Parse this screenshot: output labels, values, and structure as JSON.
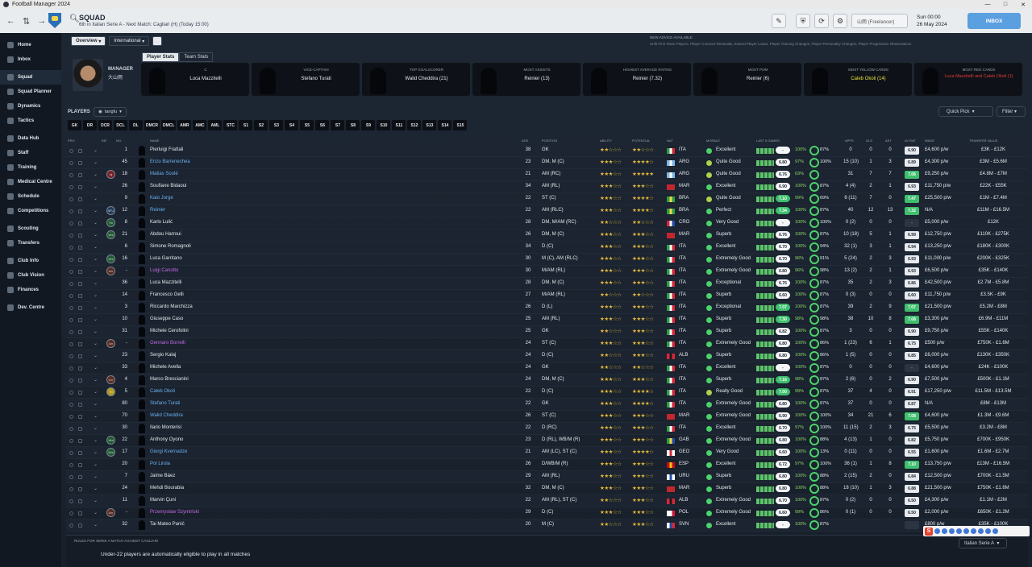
{
  "window": {
    "title": "Football Manager 2024",
    "min": "—",
    "max": "□",
    "close": "✕"
  },
  "header": {
    "title": "SQUAD",
    "subtitle": "6th in Italian Serie A - Next Match: Cagliari (H) (Today 15:00)",
    "profile": "山雨 (Freelancer)",
    "date_time": "Sun 00:00",
    "date_day": "26 May 2024",
    "inbox_label": "INBOX"
  },
  "sidebar": [
    {
      "label": "Home"
    },
    {
      "label": "Inbox"
    },
    {
      "label": "Squad",
      "active": true
    },
    {
      "label": "Squad Planner"
    },
    {
      "label": "Dynamics"
    },
    {
      "label": "Tactics"
    },
    {
      "label": "Data Hub"
    },
    {
      "label": "Staff"
    },
    {
      "label": "Training"
    },
    {
      "label": "Medical Centre"
    },
    {
      "label": "Schedule"
    },
    {
      "label": "Competitions"
    },
    {
      "label": "Scouting"
    },
    {
      "label": "Transfers"
    },
    {
      "label": "Club Info"
    },
    {
      "label": "Club Vision"
    },
    {
      "label": "Finances"
    },
    {
      "label": "Dev. Centre"
    }
  ],
  "tabs": {
    "overview": "Overview",
    "international": "International"
  },
  "advice": {
    "title": "NEW ADVICE AVAILABLE",
    "text": "Unfit First Team Players, Player Contract Renewals, Extend Player Loans, Player Training Changes, Player Personality Changes, Player Progression Observations"
  },
  "manager": {
    "label": "MANAGER",
    "name": "大山雨"
  },
  "stat_tabs": {
    "player": "Player Stats",
    "team": "Team Stats"
  },
  "cards": [
    {
      "role": "C",
      "name": "Luca Mazzitelli",
      "style": ""
    },
    {
      "role": "VICE-CAPTAIN",
      "name": "Stefano Turati",
      "style": ""
    },
    {
      "role": "TOP GOALSCORER",
      "name": "Walid Cheddira (21)",
      "style": ""
    },
    {
      "role": "MOST ASSISTS",
      "name": "Reinier (13)",
      "style": ""
    },
    {
      "role": "HIGHEST AVERAGE RATING",
      "name": "Reinier (7.32)",
      "style": ""
    },
    {
      "role": "MOST POM",
      "name": "Reinier (6)",
      "style": ""
    },
    {
      "role": "MOST YELLOW CARDS",
      "name": "Caleb Okoli (14)",
      "style": "yel"
    },
    {
      "role": "MOST RED CARDS",
      "name": "Luca Mazzitelli and Caleb Okoli (1)",
      "style": "red"
    }
  ],
  "players_bar": {
    "label": "PLAYERS",
    "view": "tangfu",
    "quick_pick": "Quick Pick",
    "filter": "Filter"
  },
  "positions": [
    "GK",
    "DR",
    "DCR",
    "DCL",
    "DL",
    "DMCR",
    "DMCL",
    "AMR",
    "AMC",
    "AML",
    "STC",
    "S1",
    "S2",
    "S3",
    "S4",
    "S5",
    "S6",
    "S7",
    "S8",
    "S9",
    "S10",
    "S11",
    "S12",
    "S13",
    "S14",
    "S15"
  ],
  "columns": {
    "pro": "PRO",
    "inf": "INF",
    "no": "NO.",
    "name": "NAME",
    "age": "AGE",
    "position": "POSITION",
    "ability": "ABILITY",
    "potential": "POTENTIAL",
    "nat": "NAT",
    "morale": "MORALE",
    "last5": "LAST 5 GAMES",
    "apps": "APPS",
    "gls": "GLS",
    "ast": "AST",
    "avrat": "AV RAT",
    "wage": "WAGE",
    "tv": "TRANSFER VALUE"
  },
  "players": [
    {
      "inf": "",
      "no": "1",
      "name": "Pierluigi Frattali",
      "age": "38",
      "pos": "GK",
      "ab": 2,
      "pot": 2,
      "flag": "ita",
      "nat": "ITA",
      "morale": "Excellent",
      "mc": "#4bd26a",
      "avg": "-",
      "fit": "100%",
      "cond": "87%",
      "apps": "0",
      "gls": "0",
      "ast": "0",
      "avr": "6.90",
      "wage": "£4,600 p/w",
      "tv": "£3K - £12K",
      "cls": ""
    },
    {
      "inf": "",
      "no": "45",
      "name": "Enzo Barrenechea",
      "age": "23",
      "pos": "DM, M (C)",
      "ab": 3,
      "pot": 4,
      "flag": "arg",
      "nat": "ARG",
      "morale": "Quite Good",
      "mc": "#a9d34c",
      "avg": "6.80",
      "fit": "97%",
      "cond": "100%",
      "apps": "15 (10)",
      "gls": "1",
      "ast": "3",
      "avr": "6.89",
      "wage": "£4,300 p/w",
      "tv": "£3M - £5.6M",
      "cls": "lnk"
    },
    {
      "inf": "Inj",
      "no": "18",
      "name": "Matias Soulé",
      "age": "21",
      "pos": "AM (RC)",
      "ab": 3,
      "pot": 5,
      "flag": "arg",
      "nat": "ARG",
      "morale": "Quite Good",
      "mc": "#a9d34c",
      "avg": "6.76",
      "fit": "63%",
      "cond": "",
      "apps": "31",
      "gls": "7",
      "ast": "7",
      "avr": "7.06",
      "wage": "£9,250 p/w",
      "tv": "£4.8M - £7M",
      "cls": "lnk"
    },
    {
      "inf": "",
      "no": "26",
      "name": "Soufiane Bidaoui",
      "age": "34",
      "pos": "AM (RL)",
      "ab": 3,
      "pot": 3,
      "flag": "mar",
      "nat": "MAR",
      "morale": "Excellent",
      "mc": "#4bd26a",
      "avg": "6.90",
      "fit": "100%",
      "cond": "87%",
      "apps": "4 (4)",
      "gls": "2",
      "ast": "1",
      "avr": "6.93",
      "wage": "£11,750 p/w",
      "tv": "£22K - £55K",
      "cls": ""
    },
    {
      "inf": "",
      "no": "9",
      "name": "Kaio Jorge",
      "age": "22",
      "pos": "ST (C)",
      "ab": 3,
      "pot": 4,
      "flag": "bra",
      "nat": "BRA",
      "morale": "Quite Good",
      "mc": "#a9d34c",
      "avg": "7.10",
      "fit": "99%",
      "cond": "69%",
      "apps": "6 (11)",
      "gls": "7",
      "ast": "0",
      "avr": "7.47",
      "wage": "£25,500 p/w",
      "tv": "£1M - £7.4M",
      "cls": "lnk"
    },
    {
      "inf": "NFU",
      "no": "12",
      "name": "Reinier",
      "age": "22",
      "pos": "AM (RLC)",
      "ab": 3,
      "pot": 4,
      "flag": "bra",
      "nat": "BRA",
      "morale": "Perfect",
      "mc": "#4bd26a",
      "avg": "7.34",
      "fit": "100%",
      "cond": "87%",
      "apps": "40",
      "gls": "12",
      "ast": "13",
      "avr": "7.32",
      "wage": "N/A",
      "tv": "£11M - £16.5M",
      "cls": "lnk"
    },
    {
      "inf": "Trn",
      "no": "8",
      "name": "Karlo Lulić",
      "age": "28",
      "pos": "DM, M/AM (RC)",
      "ab": 2,
      "pot": 2,
      "flag": "cro",
      "nat": "CRO",
      "morale": "Very Good",
      "mc": "#4bd26a",
      "avg": "-",
      "fit": "100%",
      "cond": "100%",
      "apps": "0 (2)",
      "gls": "0",
      "ast": "0",
      "avr": "-",
      "wage": "£5,000 p/w",
      "tv": "£12K",
      "cls": ""
    },
    {
      "inf": "Wnt",
      "no": "21",
      "name": "Abdou Harroui",
      "age": "26",
      "pos": "DM, M (C)",
      "ab": 3,
      "pot": 3,
      "flag": "mar",
      "nat": "MAR",
      "morale": "Superb",
      "mc": "#4bd26a",
      "avg": "6.76",
      "fit": "100%",
      "cond": "87%",
      "apps": "10 (18)",
      "gls": "5",
      "ast": "1",
      "avr": "6.99",
      "wage": "£12,750 p/w",
      "tv": "£110K - £275K",
      "cls": ""
    },
    {
      "inf": "",
      "no": "6",
      "name": "Simone Romagnoli",
      "age": "34",
      "pos": "D (C)",
      "ab": 3,
      "pot": 3,
      "flag": "ita",
      "nat": "ITA",
      "morale": "Excellent",
      "mc": "#4bd26a",
      "avg": "6.70",
      "fit": "100%",
      "cond": "94%",
      "apps": "32 (1)",
      "gls": "3",
      "ast": "1",
      "avr": "6.94",
      "wage": "£13,250 p/w",
      "tv": "£180K - £300K",
      "cls": ""
    },
    {
      "inf": "Wnt",
      "no": "16",
      "name": "Luca Garritano",
      "age": "30",
      "pos": "M (C), AM (RLC)",
      "ab": 3,
      "pot": 3,
      "flag": "ita",
      "nat": "ITA",
      "morale": "Extremely Good",
      "mc": "#4bd26a",
      "avg": "6.70",
      "fit": "96%",
      "cond": "91%",
      "apps": "5 (24)",
      "gls": "2",
      "ast": "3",
      "avr": "6.93",
      "wage": "£11,000 p/w",
      "tv": "£200K - £325K",
      "cls": ""
    },
    {
      "inf": "Unr",
      "no": "-",
      "name": "Luigi Canotto",
      "age": "30",
      "pos": "M/AM (RL)",
      "ab": 3,
      "pot": 3,
      "flag": "ita",
      "nat": "ITA",
      "morale": "Extremely Good",
      "mc": "#4bd26a",
      "avg": "6.80",
      "fit": "96%",
      "cond": "98%",
      "apps": "13 (2)",
      "gls": "2",
      "ast": "1",
      "avr": "6.93",
      "wage": "£6,500 p/w",
      "tv": "£35K - £140K",
      "cls": "pur"
    },
    {
      "inf": "",
      "no": "36",
      "name": "Luca Mazzitelli",
      "age": "28",
      "pos": "DM, M (C)",
      "ab": 3,
      "pot": 3,
      "flag": "ita",
      "nat": "ITA",
      "morale": "Exceptional",
      "mc": "#4bd26a",
      "avg": "6.76",
      "fit": "100%",
      "cond": "87%",
      "apps": "35",
      "gls": "2",
      "ast": "3",
      "avr": "6.86",
      "wage": "£42,500 p/w",
      "tv": "£2.7M - £5.8M",
      "cls": ""
    },
    {
      "inf": "",
      "no": "14",
      "name": "Francesco Gelli",
      "age": "27",
      "pos": "M/AM (RL)",
      "ab": 2,
      "pot": 2,
      "flag": "ita",
      "nat": "ITA",
      "morale": "Superb",
      "mc": "#4bd26a",
      "avg": "6.60",
      "fit": "100%",
      "cond": "87%",
      "apps": "0 (3)",
      "gls": "0",
      "ast": "0",
      "avr": "6.60",
      "wage": "£11,750 p/w",
      "tv": "£3.5K - £9K",
      "cls": ""
    },
    {
      "inf": "",
      "no": "3",
      "name": "Riccardo Marchizza",
      "age": "26",
      "pos": "D (L)",
      "ab": 3,
      "pot": 3,
      "flag": "ita",
      "nat": "ITA",
      "morale": "Exceptional",
      "mc": "#4bd26a",
      "avg": "7.07",
      "fit": "100%",
      "cond": "87%",
      "apps": "39",
      "gls": "2",
      "ast": "9",
      "avr": "7.07",
      "wage": "£21,500 p/w",
      "tv": "£5.2M - £8M",
      "cls": ""
    },
    {
      "inf": "",
      "no": "10",
      "name": "Giuseppe Caso",
      "age": "25",
      "pos": "AM (RL)",
      "ab": 3,
      "pot": 3,
      "flag": "ita",
      "nat": "ITA",
      "morale": "Superb",
      "mc": "#4bd26a",
      "avg": "7.30",
      "fit": "98%",
      "cond": "98%",
      "apps": "38",
      "gls": "10",
      "ast": "8",
      "avr": "7.08",
      "wage": "£3,300 p/w",
      "tv": "£6.9M - £11M",
      "cls": ""
    },
    {
      "inf": "",
      "no": "31",
      "name": "Michele Cerofolini",
      "age": "25",
      "pos": "GK",
      "ab": 2,
      "pot": 3,
      "flag": "ita",
      "nat": "ITA",
      "morale": "Superb",
      "mc": "#4bd26a",
      "avg": "6.82",
      "fit": "100%",
      "cond": "87%",
      "apps": "3",
      "gls": "0",
      "ast": "0",
      "avr": "6.90",
      "wage": "£9,750 p/w",
      "tv": "£55K - £140K",
      "cls": ""
    },
    {
      "inf": "Unr",
      "no": "-",
      "name": "Gennaro Borrelli",
      "age": "24",
      "pos": "ST (C)",
      "ab": 3,
      "pot": 3,
      "flag": "ita",
      "nat": "ITA",
      "morale": "Extremely Good",
      "mc": "#4bd26a",
      "avg": "6.80",
      "fit": "100%",
      "cond": "86%",
      "apps": "1 (23)",
      "gls": "6",
      "ast": "1",
      "avr": "6.75",
      "wage": "£500 p/w",
      "tv": "£750K - £1.6M",
      "cls": "pur"
    },
    {
      "inf": "",
      "no": "23",
      "name": "Sergio Kalaj",
      "age": "24",
      "pos": "D (C)",
      "ab": 2,
      "pot": 3,
      "flag": "alb",
      "nat": "ALB",
      "morale": "Superb",
      "mc": "#4bd26a",
      "avg": "6.80",
      "fit": "100%",
      "cond": "86%",
      "apps": "1 (5)",
      "gls": "0",
      "ast": "0",
      "avr": "6.85",
      "wage": "£6,000 p/w",
      "tv": "£130K - £350K",
      "cls": ""
    },
    {
      "inf": "",
      "no": "33",
      "name": "Michele Avella",
      "age": "24",
      "pos": "GK",
      "ab": 2,
      "pot": 2,
      "flag": "ita",
      "nat": "ITA",
      "morale": "Excellent",
      "mc": "#4bd26a",
      "avg": "-",
      "fit": "100%",
      "cond": "87%",
      "apps": "0",
      "gls": "0",
      "ast": "0",
      "avr": "-",
      "wage": "£4,600 p/w",
      "tv": "£24K - £100K",
      "cls": ""
    },
    {
      "inf": "Unr",
      "no": "4",
      "name": "Marco Brescianini",
      "age": "24",
      "pos": "DM, M (C)",
      "ab": 3,
      "pot": 3,
      "flag": "ita",
      "nat": "ITA",
      "morale": "Superb",
      "mc": "#4bd26a",
      "avg": "7.16",
      "fit": "98%",
      "cond": "87%",
      "apps": "2 (6)",
      "gls": "0",
      "ast": "2",
      "avr": "6.90",
      "wage": "£7,500 p/w",
      "tv": "£500K - £1.1M",
      "cls": ""
    },
    {
      "inf": "Yel",
      "no": "5",
      "name": "Caleb Okoli",
      "age": "22",
      "pos": "D (C)",
      "ab": 3,
      "pot": 4,
      "flag": "ita",
      "nat": "ITA",
      "morale": "Really Good",
      "mc": "#a9d34c",
      "avg": "7.00",
      "fit": "99%",
      "cond": "87%",
      "apps": "37",
      "gls": "4",
      "ast": "0",
      "avr": "6.91",
      "wage": "£17,250 p/w",
      "tv": "£11.5M - £13.5M",
      "cls": "lnk"
    },
    {
      "inf": "",
      "no": "80",
      "name": "Stefano Turati",
      "age": "22",
      "pos": "GK",
      "ab": 3,
      "pot": 4,
      "flag": "ita",
      "nat": "ITA",
      "morale": "Extremely Good",
      "mc": "#4bd26a",
      "avg": "6.80",
      "fit": "100%",
      "cond": "87%",
      "apps": "37",
      "gls": "0",
      "ast": "0",
      "avr": "6.87",
      "wage": "N/A",
      "tv": "£8M - £13M",
      "cls": "lnk"
    },
    {
      "inf": "",
      "no": "70",
      "name": "Walid Cheddira",
      "age": "26",
      "pos": "ST (C)",
      "ab": 3,
      "pot": 3,
      "flag": "mar",
      "nat": "MAR",
      "morale": "Extremely Good",
      "mc": "#4bd26a",
      "avg": "6.90",
      "fit": "100%",
      "cond": "100%",
      "apps": "34",
      "gls": "21",
      "ast": "6",
      "avr": "7.08",
      "wage": "£4,600 p/w",
      "tv": "£1.3M - £9.6M",
      "cls": "lnk"
    },
    {
      "inf": "",
      "no": "30",
      "name": "Ilario Monterisi",
      "age": "22",
      "pos": "D (RC)",
      "ab": 3,
      "pot": 3,
      "flag": "ita",
      "nat": "ITA",
      "morale": "Excellent",
      "mc": "#4bd26a",
      "avg": "6.70",
      "fit": "97%",
      "cond": "100%",
      "apps": "11 (15)",
      "gls": "2",
      "ast": "3",
      "avr": "6.75",
      "wage": "£5,500 p/w",
      "tv": "£3.2M - £8M",
      "cls": ""
    },
    {
      "inf": "Wnt",
      "no": "22",
      "name": "Anthony Oyono",
      "age": "23",
      "pos": "D (RL), WB/M (R)",
      "ab": 3,
      "pot": 3,
      "flag": "gab",
      "nat": "GAB",
      "morale": "Extremely Good",
      "mc": "#4bd26a",
      "avg": "6.80",
      "fit": "100%",
      "cond": "88%",
      "apps": "4 (13)",
      "gls": "1",
      "ast": "0",
      "avr": "6.82",
      "wage": "£5,750 p/w",
      "tv": "£700K - £950K",
      "cls": ""
    },
    {
      "inf": "Wnt",
      "no": "17",
      "name": "Giorgi Kvernadze",
      "age": "21",
      "pos": "AM (LC), ST (C)",
      "ab": 3,
      "pot": 4,
      "flag": "geo",
      "nat": "GEO",
      "morale": "Very Good",
      "mc": "#4bd26a",
      "avg": "6.60",
      "fit": "100%",
      "cond": "13%",
      "apps": "0 (11)",
      "gls": "0",
      "ast": "0",
      "avr": "6.55",
      "wage": "£1,600 p/w",
      "tv": "£1.6M - £2.7M",
      "cls": "lnk"
    },
    {
      "inf": "",
      "no": "20",
      "name": "Pol Lirola",
      "age": "26",
      "pos": "D/WB/M (R)",
      "ab": 3,
      "pot": 3,
      "flag": "esp",
      "nat": "ESP",
      "morale": "Excellent",
      "mc": "#4bd26a",
      "avg": "6.72",
      "fit": "97%",
      "cond": "100%",
      "apps": "36 (1)",
      "gls": "1",
      "ast": "8",
      "avr": "7.10",
      "wage": "£13,750 p/w",
      "tv": "£13M - £16.5M",
      "cls": "lnk"
    },
    {
      "inf": "",
      "no": "7",
      "name": "Jaime Báez",
      "age": "29",
      "pos": "AM (RL)",
      "ab": 3,
      "pot": 3,
      "flag": "uru",
      "nat": "URU",
      "morale": "Superb",
      "mc": "#4bd26a",
      "avg": "6.80",
      "fit": "100%",
      "cond": "88%",
      "apps": "2 (15)",
      "gls": "2",
      "ast": "0",
      "avr": "6.84",
      "wage": "£12,500 p/w",
      "tv": "£700K - £1.5M",
      "cls": ""
    },
    {
      "inf": "",
      "no": "24",
      "name": "Mehdi Bourabia",
      "age": "32",
      "pos": "DM, M (C)",
      "ab": 3,
      "pot": 3,
      "flag": "mar",
      "nat": "MAR",
      "morale": "Superb",
      "mc": "#4bd26a",
      "avg": "6.80",
      "fit": "100%",
      "cond": "88%",
      "apps": "18 (10)",
      "gls": "1",
      "ast": "3",
      "avr": "6.88",
      "wage": "£21,500 p/w",
      "tv": "£750K - £1.6M",
      "cls": ""
    },
    {
      "inf": "",
      "no": "11",
      "name": "Marvin Çuni",
      "age": "22",
      "pos": "AM (RL), ST (C)",
      "ab": 2,
      "pot": 3,
      "flag": "alb",
      "nat": "ALB",
      "morale": "Extremely Good",
      "mc": "#4bd26a",
      "avg": "6.70",
      "fit": "100%",
      "cond": "87%",
      "apps": "0 (2)",
      "gls": "0",
      "ast": "0",
      "avr": "6.50",
      "wage": "£4,300 p/w",
      "tv": "£1.1M - £2M",
      "cls": ""
    },
    {
      "inf": "Unr",
      "no": "-",
      "name": "Przemysław Szymiński",
      "age": "29",
      "pos": "D (C)",
      "ab": 3,
      "pot": 3,
      "flag": "pol",
      "nat": "POL",
      "morale": "Extremely Good",
      "mc": "#4bd26a",
      "avg": "6.60",
      "fit": "99%",
      "cond": "86%",
      "apps": "0 (1)",
      "gls": "0",
      "ast": "0",
      "avr": "6.50",
      "wage": "£2,000 p/w",
      "tv": "£650K - £1.2M",
      "cls": "pur"
    },
    {
      "inf": "",
      "no": "32",
      "name": "Tai Mateo Panić",
      "age": "20",
      "pos": "M (C)",
      "ab": 2,
      "pot": 3,
      "flag": "svn",
      "nat": "SVN",
      "morale": "Excellent",
      "mc": "#4bd26a",
      "avg": "-",
      "fit": "100%",
      "cond": "87%",
      "apps": "",
      "gls": "",
      "ast": "",
      "avr": "",
      "wage": "£800 p/w",
      "tv": "£35K - £100K",
      "cls": ""
    }
  ],
  "rules": {
    "heading": "RULES FOR SERIE A MATCH AGAINST CAGLIARI",
    "text": "Under-22 players are automatically eligible to play in all matches",
    "competition": "Italian Serie A"
  },
  "flags": {
    "ita": [
      "#2e9e44",
      "#ffffff",
      "#d6283a"
    ],
    "arg": [
      "#7fb8e8",
      "#ffffff",
      "#7fb8e8"
    ],
    "mar": [
      "#c1272d",
      "#c1272d",
      "#c1272d"
    ],
    "bra": [
      "#2f9e44",
      "#f1d64a",
      "#2f9e44"
    ],
    "cro": [
      "#d6283a",
      "#ffffff",
      "#1f4fa8"
    ],
    "alb": [
      "#d6283a",
      "#1a1a1a",
      "#d6283a"
    ],
    "gab": [
      "#2e9e44",
      "#f1d64a",
      "#1f4fa8"
    ],
    "geo": [
      "#ffffff",
      "#d6283a",
      "#ffffff"
    ],
    "esp": [
      "#c60b1e",
      "#ffc400",
      "#c60b1e"
    ],
    "uru": [
      "#ffffff",
      "#1f4fa8",
      "#ffffff"
    ],
    "pol": [
      "#ffffff",
      "#ffffff",
      "#dc143c"
    ],
    "svn": [
      "#ffffff",
      "#1f4fa8",
      "#d6283a"
    ]
  }
}
